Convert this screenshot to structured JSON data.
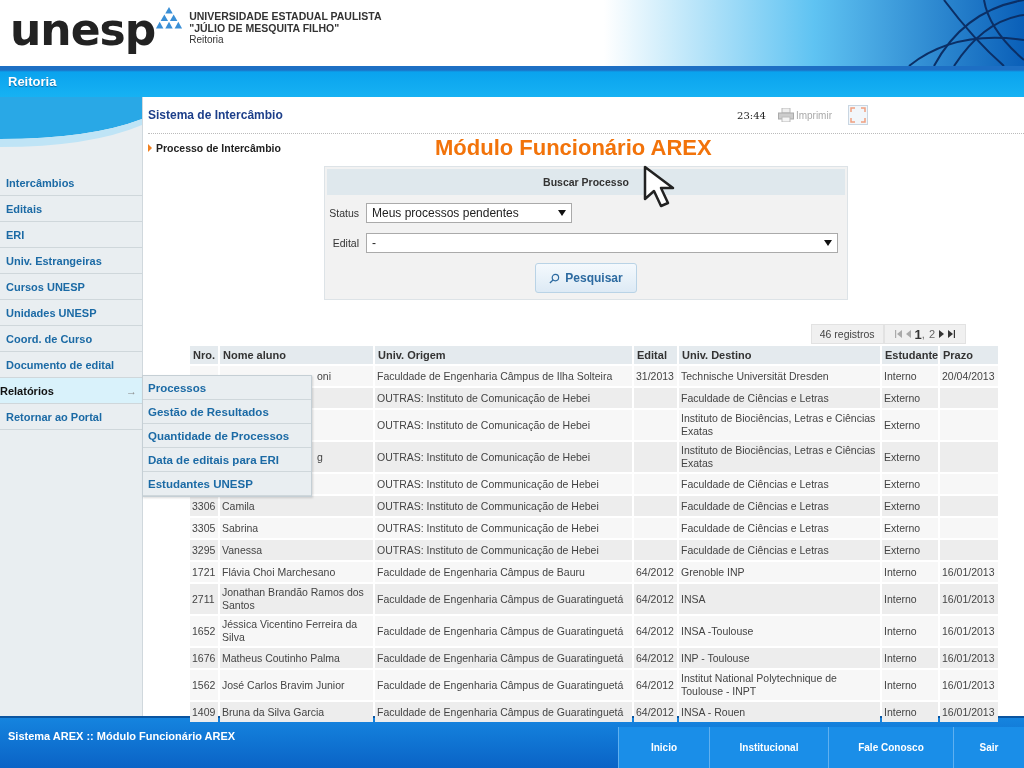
{
  "header": {
    "logo": "unesp",
    "university": "UNIVERSIDADE ESTADUAL PAULISTA",
    "university_name": "\"JÚLIO DE MESQUITA FILHO\"",
    "unit": "Reitoria"
  },
  "bar_title": "Reitoria",
  "sidebar": {
    "items": [
      {
        "label": "Intercâmbios",
        "selected": false
      },
      {
        "label": "Editais",
        "selected": false
      },
      {
        "label": "ERI",
        "selected": false
      },
      {
        "label": "Univ. Estrangeiras",
        "selected": false
      },
      {
        "label": "Cursos UNESP",
        "selected": false
      },
      {
        "label": "Unidades UNESP",
        "selected": false
      },
      {
        "label": "Coord. de Curso",
        "selected": false
      },
      {
        "label": "Documento de edital",
        "selected": false
      },
      {
        "label": "Relatórios",
        "selected": true,
        "arrow": "→",
        "children": [
          {
            "label": "Processos"
          },
          {
            "label": "Gestão de Resultados"
          },
          {
            "label": "Quantidade de Processos"
          },
          {
            "label": "Data de editais para ERI"
          },
          {
            "label": "Estudantes UNESP"
          }
        ]
      },
      {
        "label": "Retornar ao Portal",
        "selected": false
      }
    ]
  },
  "page": {
    "title": "Sistema de Intercâmbio",
    "time": "23:44",
    "print": {
      "label": "Imprimir",
      "disabled": true
    },
    "breadcrumb": "Processo de Intercâmbio",
    "banner": "Módulo Funcionário AREX"
  },
  "search": {
    "title": "Buscar Processo",
    "fields": [
      {
        "label": "Status",
        "value": "Meus processos pendentes",
        "wide": false
      },
      {
        "label": "Edital",
        "value": "-",
        "wide": true
      }
    ],
    "button": "Pesquisar"
  },
  "pager": {
    "count": "46 registros",
    "pages": [
      {
        "label": "1",
        "selected": true
      },
      {
        "label": "2",
        "selected": false
      }
    ],
    "separator": ","
  },
  "table": {
    "columns": [
      "Nro.",
      "Nome aluno",
      "Univ. Origem",
      "Edital",
      "Univ. Destino",
      "Estudante",
      "Prazo"
    ],
    "rows": [
      {
        "covered": true,
        "nro": "",
        "name": "oni",
        "origin": "Faculdade de Engenharia Câmpus de Ilha Solteira",
        "edital": "31/2013",
        "dest": "Technische Universität Dresden",
        "student": "Interno",
        "deadline": "20/04/2013"
      },
      {
        "covered": true,
        "nro": "",
        "name": "",
        "origin": "OUTRAS: Instituto de Comunicação de Hebei",
        "edital": "",
        "dest": "Faculdade de Ciências e Letras",
        "student": "Externo",
        "deadline": ""
      },
      {
        "covered": true,
        "nro": "",
        "name": "",
        "origin": "OUTRAS: Instituto de Comunicação de Hebei",
        "edital": "",
        "dest": "Instituto de Biociências, Letras e Ciências Exatas",
        "student": "Externo",
        "deadline": ""
      },
      {
        "covered": true,
        "nro": "",
        "name": "g",
        "origin": "OUTRAS: Instituto de Comunicação de Hebei",
        "edital": "",
        "dest": "Instituto de Biociências, Letras e Ciências Exatas",
        "student": "Externo",
        "deadline": ""
      },
      {
        "covered": true,
        "nro": "",
        "name": "",
        "origin": "OUTRAS: Instituto de Communicação de Hebei",
        "edital": "",
        "dest": "Faculdade de Ciências e Letras",
        "student": "Externo",
        "deadline": ""
      },
      {
        "covered": false,
        "nro": "3306",
        "name": "Camila",
        "origin": "OUTRAS: Instituto de Communicação de Hebei",
        "edital": "",
        "dest": "Faculdade de Ciências e Letras",
        "student": "Externo",
        "deadline": ""
      },
      {
        "covered": false,
        "nro": "3305",
        "name": "Sabrina",
        "origin": "OUTRAS: Instituto de Communicação de Hebei",
        "edital": "",
        "dest": "Faculdade de Ciências e Letras",
        "student": "Externo",
        "deadline": ""
      },
      {
        "covered": false,
        "nro": "3295",
        "name": "Vanessa",
        "origin": "OUTRAS: Instituto de Communicação de Hebei",
        "edital": "",
        "dest": "Faculdade de Ciências e Letras",
        "student": "Externo",
        "deadline": ""
      },
      {
        "covered": false,
        "nro": "1721",
        "name": "Flávia Choi Marchesano",
        "origin": "Faculdade de Engenharia Câmpus de Bauru",
        "edital": "64/2012",
        "dest": "Grenoble INP",
        "student": "Interno",
        "deadline": "16/01/2013"
      },
      {
        "covered": false,
        "nro": "2711",
        "name": "Jonathan Brandão Ramos dos Santos",
        "origin": "Faculdade de Engenharia Câmpus de Guaratinguetá",
        "edital": "64/2012",
        "dest": "INSA",
        "student": "Interno",
        "deadline": "16/01/2013"
      },
      {
        "covered": false,
        "nro": "1652",
        "name": "Jéssica Vicentino Ferreira da Silva",
        "origin": "Faculdade de Engenharia Câmpus de Guaratinguetá",
        "edital": "64/2012",
        "dest": "INSA -Toulouse",
        "student": "Interno",
        "deadline": "16/01/2013"
      },
      {
        "covered": false,
        "nro": "1676",
        "name": "Matheus Coutinho Palma",
        "origin": "Faculdade de Engenharia Câmpus de Guaratinguetá",
        "edital": "64/2012",
        "dest": "INP - Toulouse",
        "student": "Interno",
        "deadline": "16/01/2013"
      },
      {
        "covered": false,
        "nro": "1562",
        "name": "José Carlos Bravim Junior",
        "origin": "Faculdade de Engenharia Câmpus de Guaratinguetá",
        "edital": "64/2012",
        "dest": "Institut National Polytechnique de Toulouse - INPT",
        "student": "Interno",
        "deadline": "16/01/2013"
      },
      {
        "covered": false,
        "nro": "1409",
        "name": "Bruna da Silva Garcia",
        "origin": "Faculdade de Engenharia Câmpus de Guaratinguetá",
        "edital": "64/2012",
        "dest": "INSA - Rouen",
        "student": "Interno",
        "deadline": "16/01/2013"
      }
    ]
  },
  "footer": {
    "text": "Sistema AREX :: Módulo Funcionário AREX",
    "links": [
      "Inicio",
      "Institucional",
      "Fale Conosco",
      "Sair"
    ]
  }
}
